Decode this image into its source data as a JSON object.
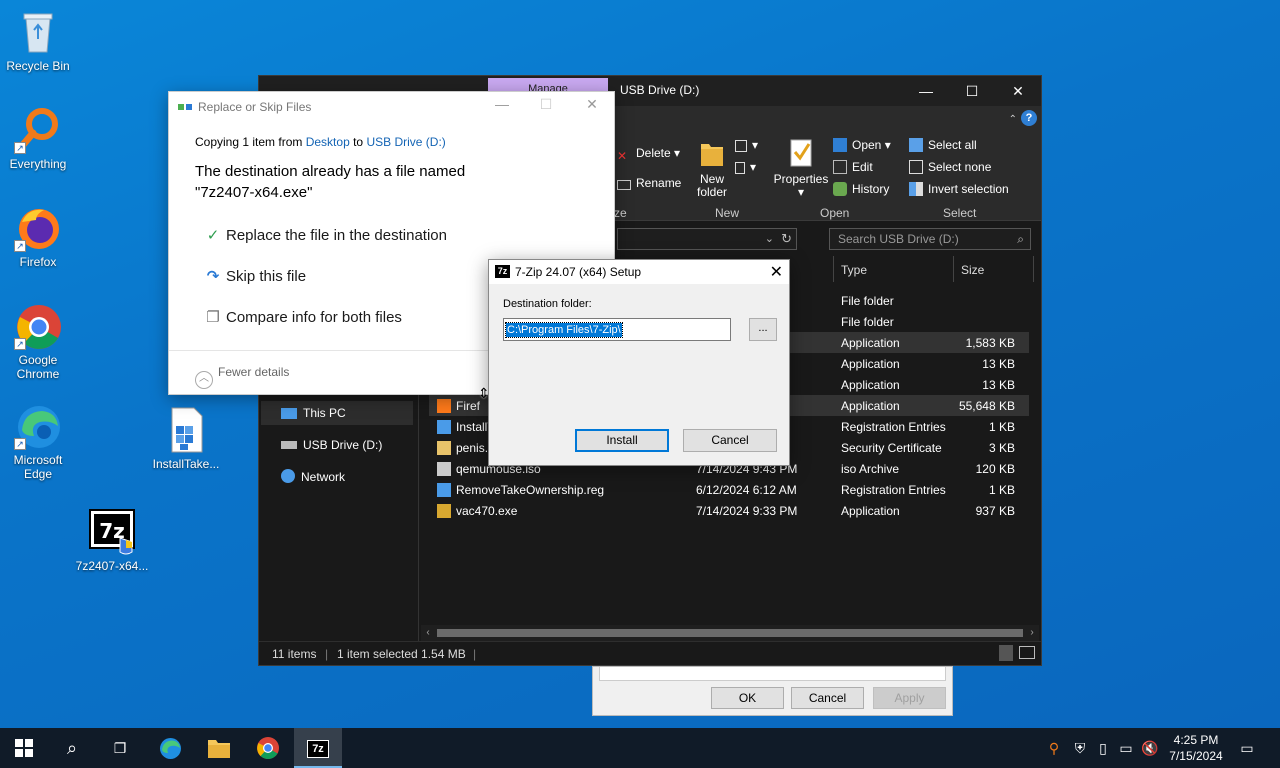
{
  "desktop": {
    "icons": [
      {
        "label": "Recycle Bin"
      },
      {
        "label": "Everything"
      },
      {
        "label": "Firefox"
      },
      {
        "label": "Google Chrome"
      },
      {
        "label": "Microsoft Edge"
      },
      {
        "label": "InstallTake..."
      },
      {
        "label": "7z2407-x64..."
      }
    ]
  },
  "explorer": {
    "context_tab": "Manage",
    "title": "USB Drive (D:)",
    "ribbon": {
      "delete": "Delete",
      "rename": "Rename",
      "new_folder": "New folder",
      "properties": "Properties",
      "open": "Open",
      "edit": "Edit",
      "history": "History",
      "select_all": "Select all",
      "select_none": "Select none",
      "invert_selection": "Invert selection",
      "groups": {
        "organize": "ze",
        "new": "New",
        "open": "Open",
        "select": "Select"
      }
    },
    "search_placeholder": "Search USB Drive (D:)",
    "nav": {
      "this_pc": "This PC",
      "usb_drive": "USB Drive (D:)",
      "network": "Network"
    },
    "columns": {
      "type": "Type",
      "size": "Size"
    },
    "files": [
      {
        "name": "",
        "date": "",
        "type": "File folder",
        "size": ""
      },
      {
        "name": "",
        "date": "",
        "type": "File folder",
        "size": ""
      },
      {
        "name": "",
        "date": "",
        "type": "Application",
        "size": "1,583 KB"
      },
      {
        "name": "",
        "date": "",
        "type": "Application",
        "size": "13 KB"
      },
      {
        "name": "",
        "date": "",
        "type": "Application",
        "size": "13 KB"
      },
      {
        "name": "Firef",
        "date": "",
        "type": "Application",
        "size": "55,648 KB"
      },
      {
        "name": "InstallT",
        "date": "",
        "type": "Registration Entries",
        "size": "1 KB"
      },
      {
        "name": "penis.c",
        "date": "",
        "type": "Security Certificate",
        "size": "3 KB"
      },
      {
        "name": "qemumouse.iso",
        "date": "7/14/2024 9:43 PM",
        "type": "iso Archive",
        "size": "120 KB"
      },
      {
        "name": "RemoveTakeOwnership.reg",
        "date": "6/12/2024 6:12 AM",
        "type": "Registration Entries",
        "size": "1 KB"
      },
      {
        "name": "vac470.exe",
        "date": "7/14/2024 9:33 PM",
        "type": "Application",
        "size": "937 KB"
      }
    ],
    "status": {
      "items": "11 items",
      "selected": "1 item selected  1.54 MB",
      "sep": "|"
    }
  },
  "properties_dialog": {
    "ok": "OK",
    "cancel": "Cancel",
    "apply": "Apply"
  },
  "replace_dialog": {
    "title": "Replace or Skip Files",
    "copying_prefix": "Copying 1 item from ",
    "source": "Desktop",
    "to": " to ",
    "destination": "USB Drive (D:)",
    "message_line1": "The destination already has a file named",
    "message_line2": "\"7z2407-x64.exe\"",
    "option_replace": "Replace the file in the destination",
    "option_skip": "Skip this file",
    "option_compare": "Compare info for both files",
    "fewer_details": "Fewer details"
  },
  "setup_dialog": {
    "title": "7-Zip 24.07 (x64) Setup",
    "icon_text": "7z",
    "dest_label": "Destination folder:",
    "dest_value": "C:\\Program Files\\7-Zip\\",
    "browse": "...",
    "install": "Install",
    "cancel": "Cancel"
  },
  "taskbar": {
    "time": "4:25 PM",
    "date": "7/15/2024",
    "app_7z_label": "7z"
  }
}
